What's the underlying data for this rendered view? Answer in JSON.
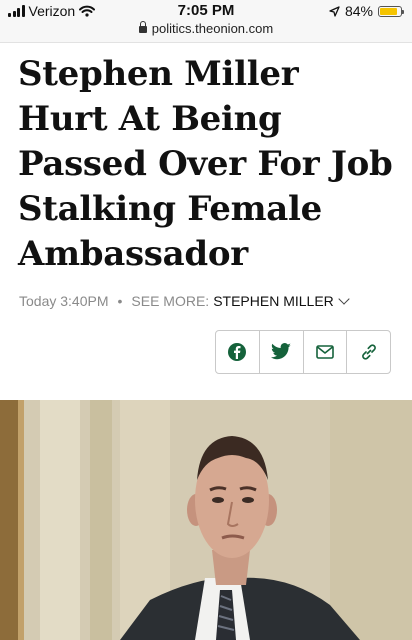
{
  "status_bar": {
    "carrier": "Verizon",
    "time": "7:05 PM",
    "battery": "84%",
    "battery_level": 0.84
  },
  "address_bar": {
    "url": "politics.theonion.com"
  },
  "article": {
    "headline": "Stephen Miller Hurt At Being Passed Over For Job Stalking Female Ambassador",
    "timestamp": "Today 3:40PM",
    "see_more_label": "SEE MORE:",
    "tag": "STEPHEN MILLER"
  },
  "share_icons": [
    "facebook-icon",
    "twitter-icon",
    "email-icon",
    "link-icon"
  ],
  "colors": {
    "share_icon": "#15623b",
    "battery": "#f5c400"
  }
}
